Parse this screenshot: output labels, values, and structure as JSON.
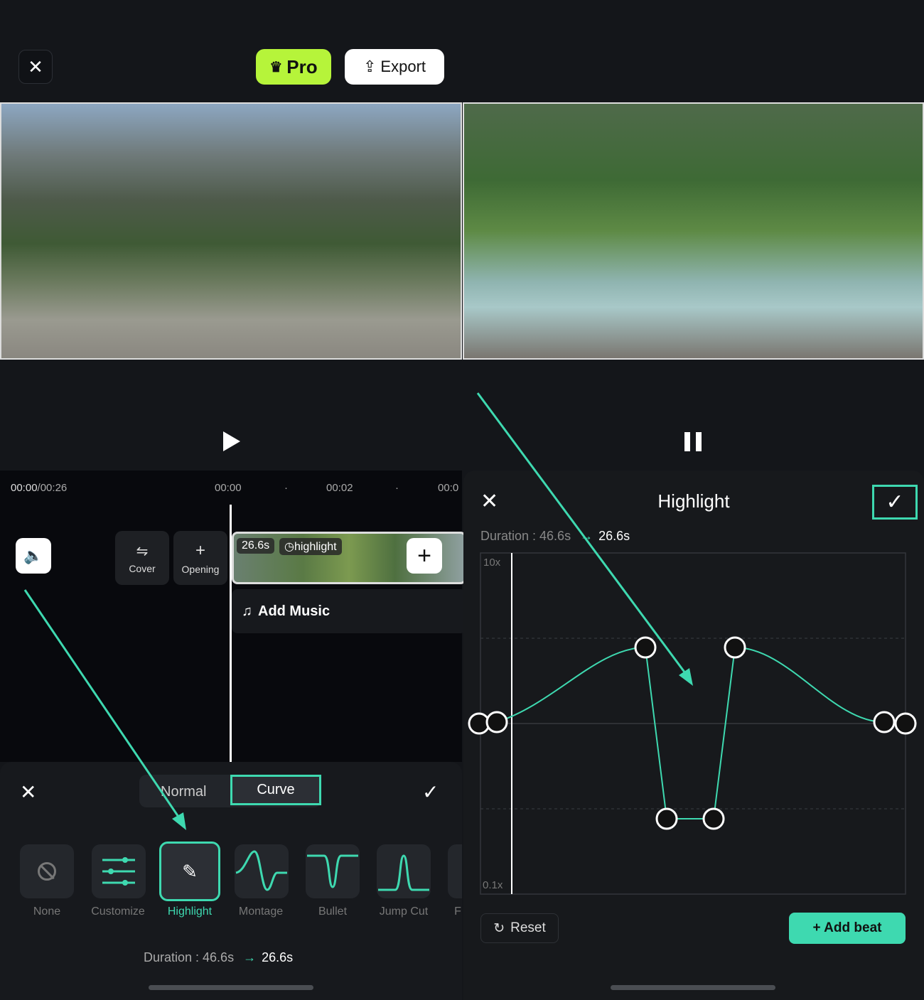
{
  "header": {
    "close_icon": "close-icon",
    "pro_label": "Pro",
    "export_label": "Export"
  },
  "timeline": {
    "current": "00:00",
    "total": "/00:26",
    "ticks": [
      "00:00",
      "00:02",
      "00:0"
    ],
    "clip_duration": "26.6s",
    "clip_tag": "highlight",
    "cover_label": "Cover",
    "opening_label": "Opening",
    "add_music_label": "Add Music"
  },
  "speed_panel": {
    "mode_normal": "Normal",
    "mode_curve": "Curve",
    "presets": [
      {
        "label": "None"
      },
      {
        "label": "Customize"
      },
      {
        "label": "Highlight",
        "selected": true
      },
      {
        "label": "Montage"
      },
      {
        "label": "Bullet"
      },
      {
        "label": "Jump Cut"
      },
      {
        "label": "F"
      }
    ],
    "duration_label": "Duration : 46.6s",
    "duration_new": "26.6s"
  },
  "highlight_editor": {
    "title": "Highlight",
    "duration_label": "Duration : 46.6s",
    "duration_new": "26.6s",
    "y_max": "10x",
    "y_min": "0.1x",
    "reset_label": "Reset",
    "add_beat_label": "+ Add beat"
  },
  "colors": {
    "accent": "#3ed9b0",
    "pro": "#b6f43a",
    "background": "#14161a"
  }
}
